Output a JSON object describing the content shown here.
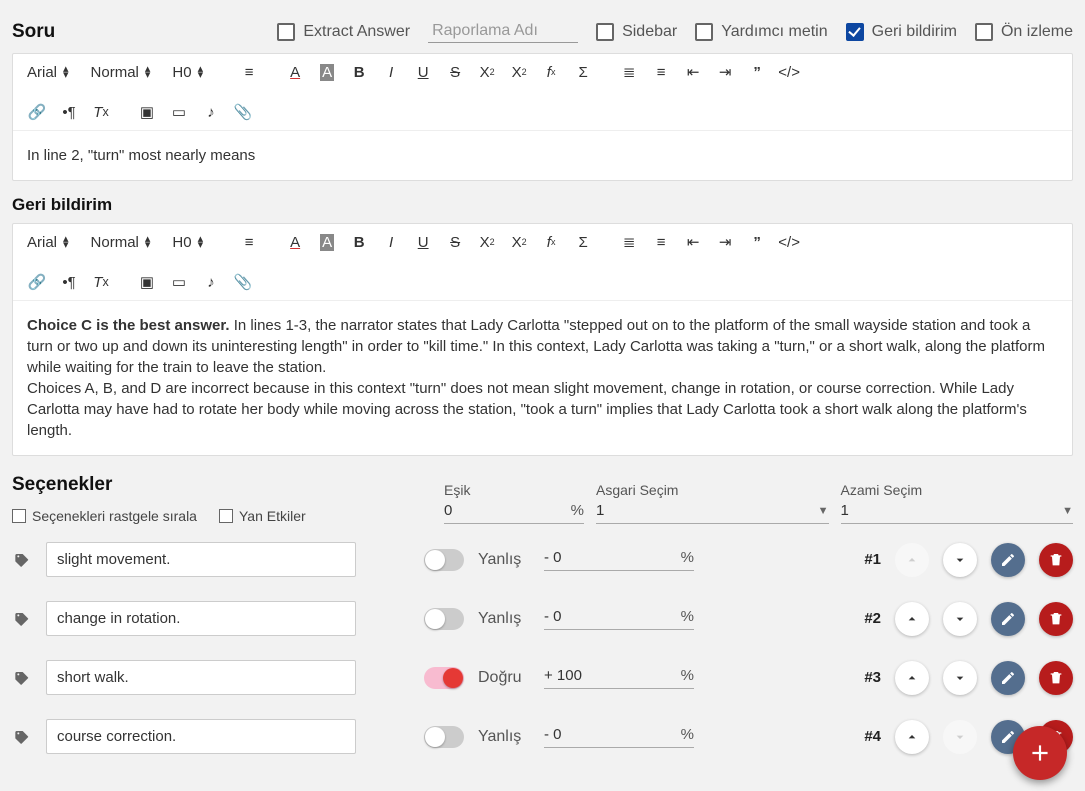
{
  "header": {
    "title": "Soru",
    "extract_answer_label": "Extract Answer",
    "report_placeholder": "Raporlama Adı",
    "sidebar_label": "Sidebar",
    "helper_label": "Yardımcı metin",
    "feedback_label": "Geri bildirim",
    "preview_label": "Ön izleme",
    "feedback_checked": true
  },
  "toolbar": {
    "font": "Arial",
    "weight": "Normal",
    "heading": "H0"
  },
  "question_content": "In line 2, \"turn\" most nearly means",
  "feedback_title": "Geri bildirim",
  "feedback_bold": "Choice C is the best answer.",
  "feedback_rest": " In lines 1-3, the narrator states that Lady Carlotta \"stepped out on to the platform of the small wayside station and took a turn or two up and down its uninteresting length\" in order to \"kill time.\" In this context, Lady Carlotta was taking a \"turn,\" or a short walk, along the platform while waiting for the train to leave the station.",
  "feedback_para2": "Choices A, B, and D are incorrect because in this context \"turn\" does not mean slight movement, change in rotation, or course correction. While Lady Carlotta may have had to rotate her body while moving across the station, \"took a turn\" implies that Lady Carlotta took a short walk along the platform's length.",
  "options_header": {
    "title": "Seçenekler",
    "shuffle_label": "Seçenekleri rastgele sırala",
    "side_effects_label": "Yan Etkiler",
    "threshold_label": "Eşik",
    "threshold_value": "0",
    "min_label": "Asgari Seçim",
    "min_value": "1",
    "max_label": "Azami Seçim",
    "max_value": "1"
  },
  "toggle_labels": {
    "on": "Doğru",
    "off": "Yanlış"
  },
  "options": [
    {
      "text": "slight movement.",
      "correct": false,
      "score": "- 0",
      "pos": "#1",
      "up_disabled": true,
      "down_disabled": false
    },
    {
      "text": "change in rotation.",
      "correct": false,
      "score": "- 0",
      "pos": "#2",
      "up_disabled": false,
      "down_disabled": false
    },
    {
      "text": "short walk.",
      "correct": true,
      "score": "+ 100",
      "pos": "#3",
      "up_disabled": false,
      "down_disabled": false
    },
    {
      "text": "course correction.",
      "correct": false,
      "score": "- 0",
      "pos": "#4",
      "up_disabled": false,
      "down_disabled": true
    }
  ],
  "percent": "%"
}
